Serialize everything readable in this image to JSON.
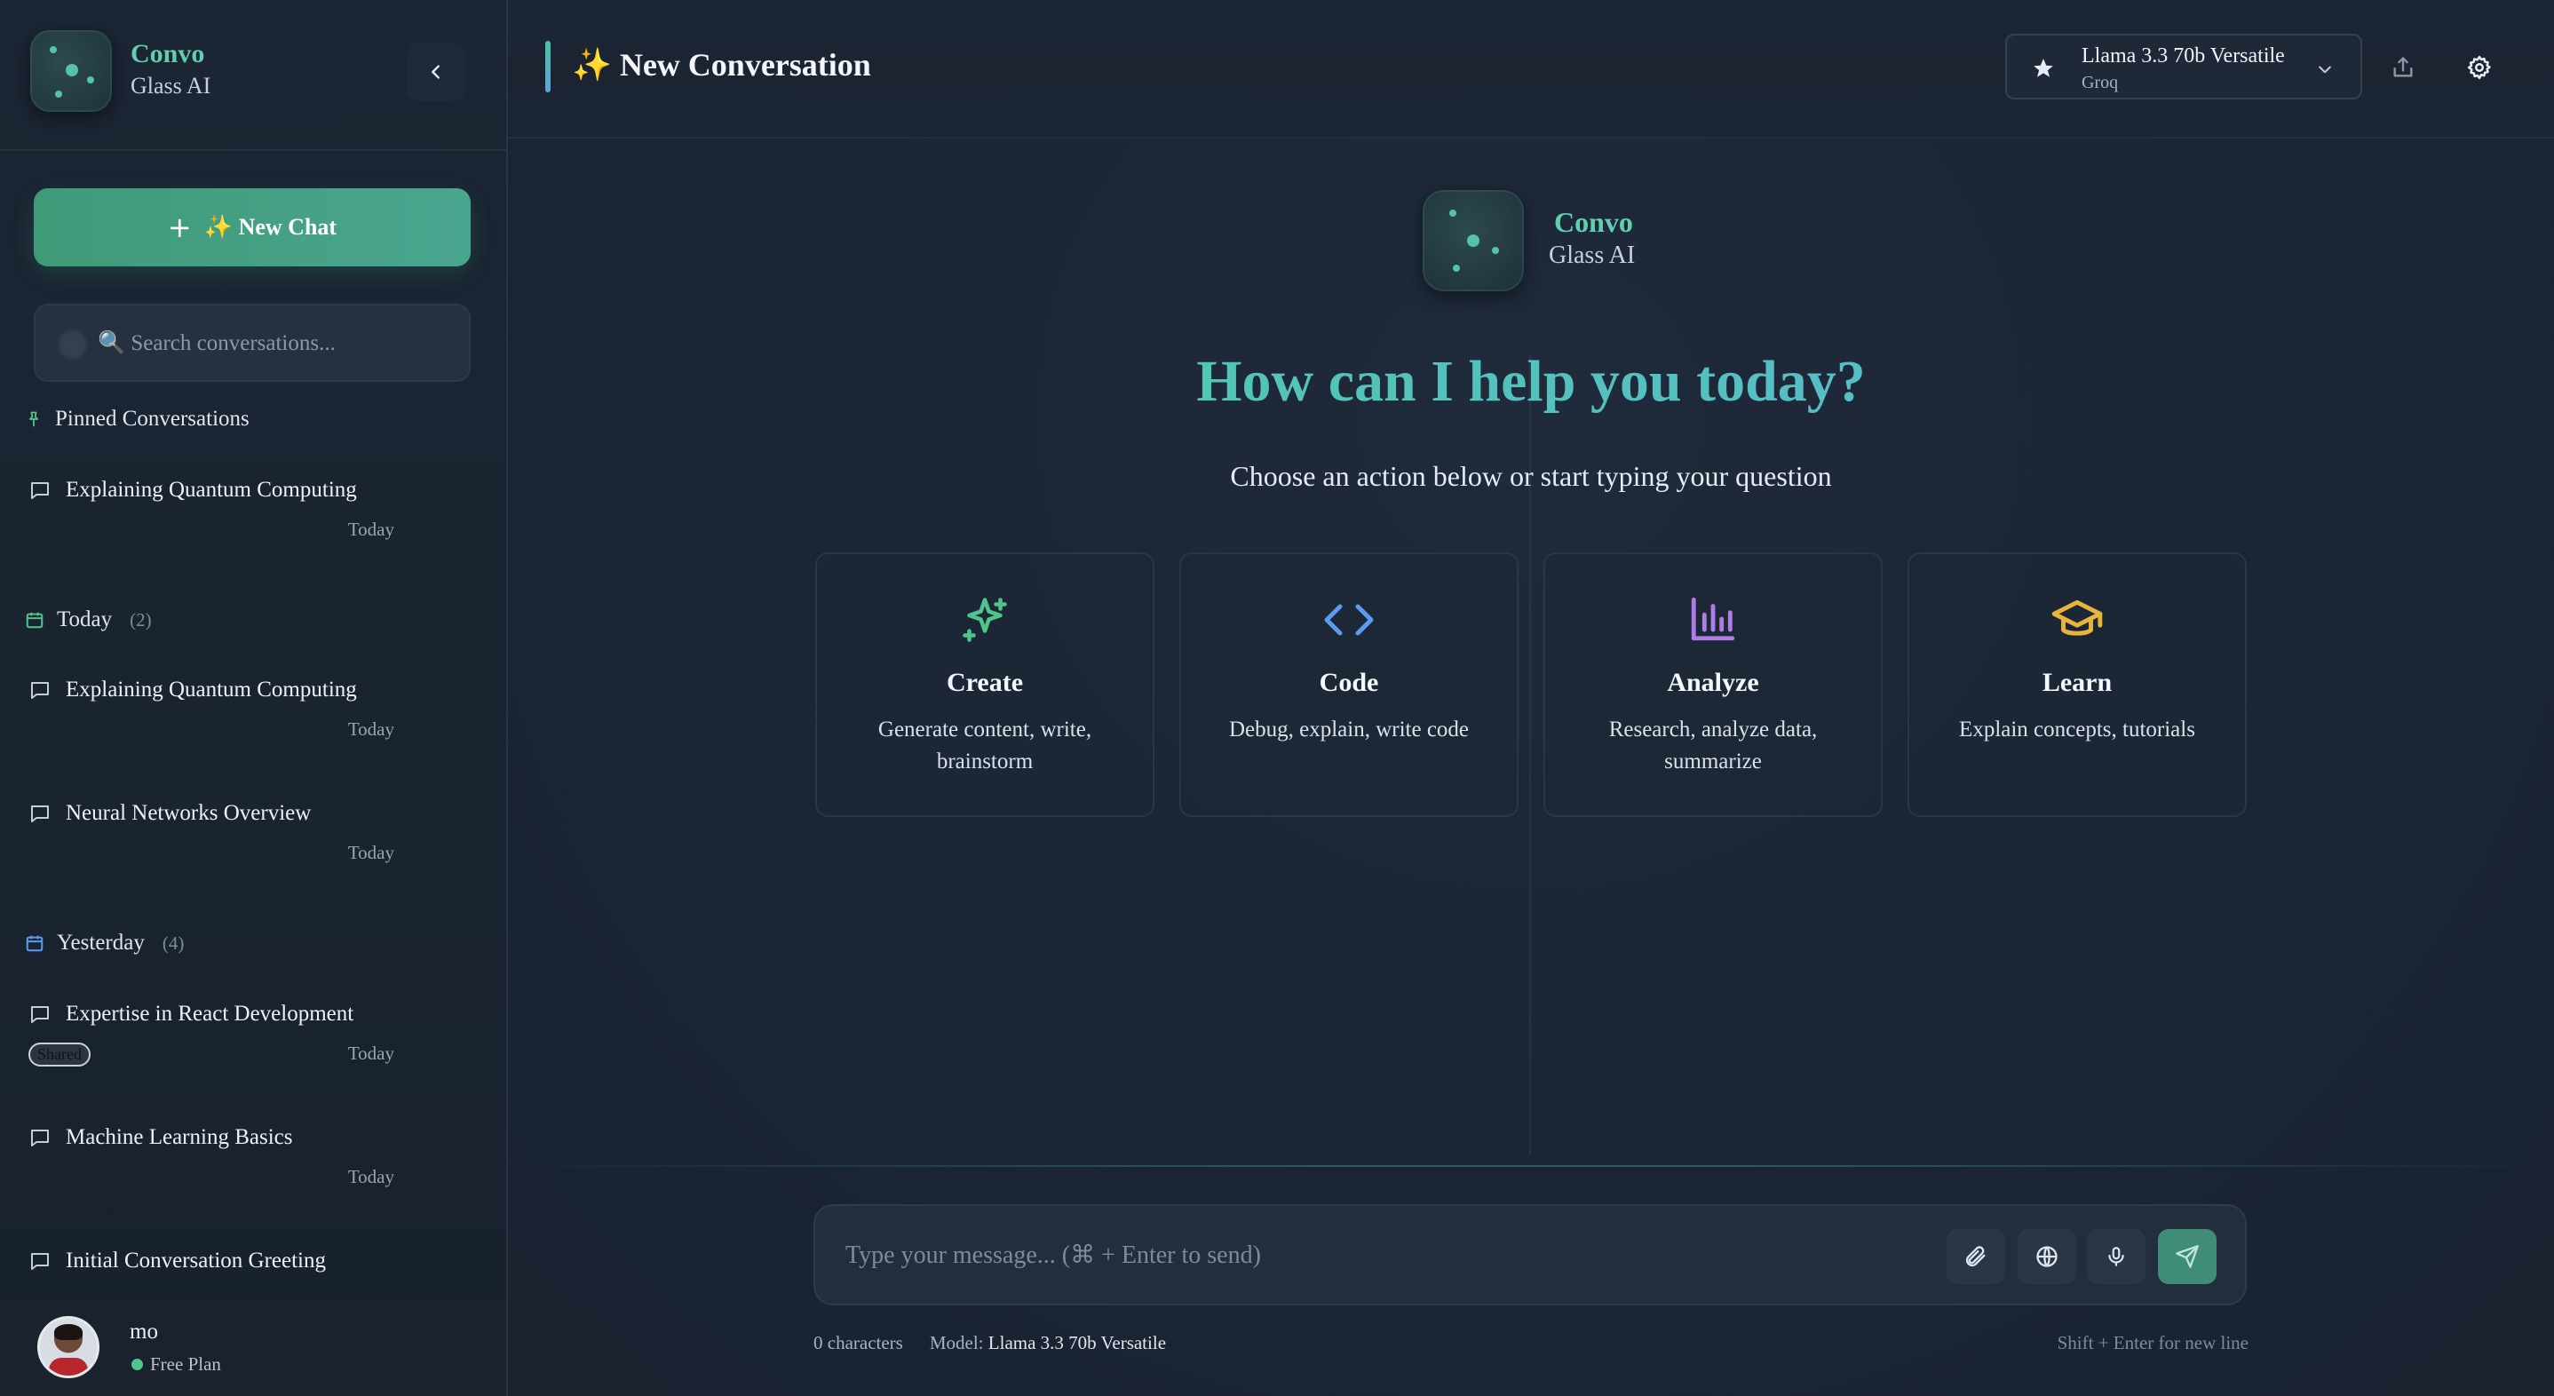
{
  "sidebar": {
    "brand": {
      "name": "Convo",
      "sub": "Glass AI"
    },
    "new_chat": {
      "icon": "+",
      "label": "✨ New Chat"
    },
    "search": {
      "placeholder": "🔍 Search conversations..."
    },
    "sections": {
      "pinned": {
        "label": "Pinned Conversations"
      },
      "today": {
        "label": "Today",
        "count": "(2)"
      },
      "yesterday": {
        "label": "Yesterday",
        "count": "(4)"
      }
    },
    "conversations": [
      {
        "title": "Explaining Quantum Computing",
        "date": "Today",
        "badge": ""
      },
      {
        "title": "Explaining Quantum Computing",
        "date": "Today",
        "badge": ""
      },
      {
        "title": "Neural Networks Overview",
        "date": "Today",
        "badge": ""
      },
      {
        "title": "Expertise in React Development",
        "date": "Today",
        "badge": "Shared"
      },
      {
        "title": "Machine Learning Basics",
        "date": "Today",
        "badge": ""
      },
      {
        "title": "Initial Conversation Greeting",
        "date": "",
        "badge": ""
      }
    ],
    "user": {
      "name": "mo",
      "plan": "Free Plan"
    }
  },
  "topbar": {
    "title": "✨ New Conversation",
    "model": {
      "name": "Llama 3.3 70b Versatile",
      "provider": "Groq"
    }
  },
  "hero": {
    "brand": {
      "name": "Convo",
      "sub": "Glass AI"
    },
    "heading": "How can I help you today?",
    "subheading": "Choose an action below or start typing your question"
  },
  "actions": [
    {
      "icon": "sparkles-icon",
      "title": "Create",
      "desc": "Generate content, write, brainstorm",
      "color": "#4fc58b"
    },
    {
      "icon": "code-icon",
      "title": "Code",
      "desc": "Debug, explain, write code",
      "color": "#5b9cf0"
    },
    {
      "icon": "bar-chart-icon",
      "title": "Analyze",
      "desc": "Research, analyze data, summarize",
      "color": "#b07ce8"
    },
    {
      "icon": "graduation-cap-icon",
      "title": "Learn",
      "desc": "Explain concepts, tutorials",
      "color": "#e9b43c"
    }
  ],
  "composer": {
    "placeholder": "Type your message... (⌘ + Enter to send)",
    "char_count": "0 characters",
    "model_label": "Model:",
    "model_value": "Llama 3.3 70b Versatile",
    "hint": "Shift + Enter for new line"
  },
  "colors": {
    "accent": "#4fbfa4",
    "background": "#1a2331",
    "sidebar": "#1b2533"
  }
}
